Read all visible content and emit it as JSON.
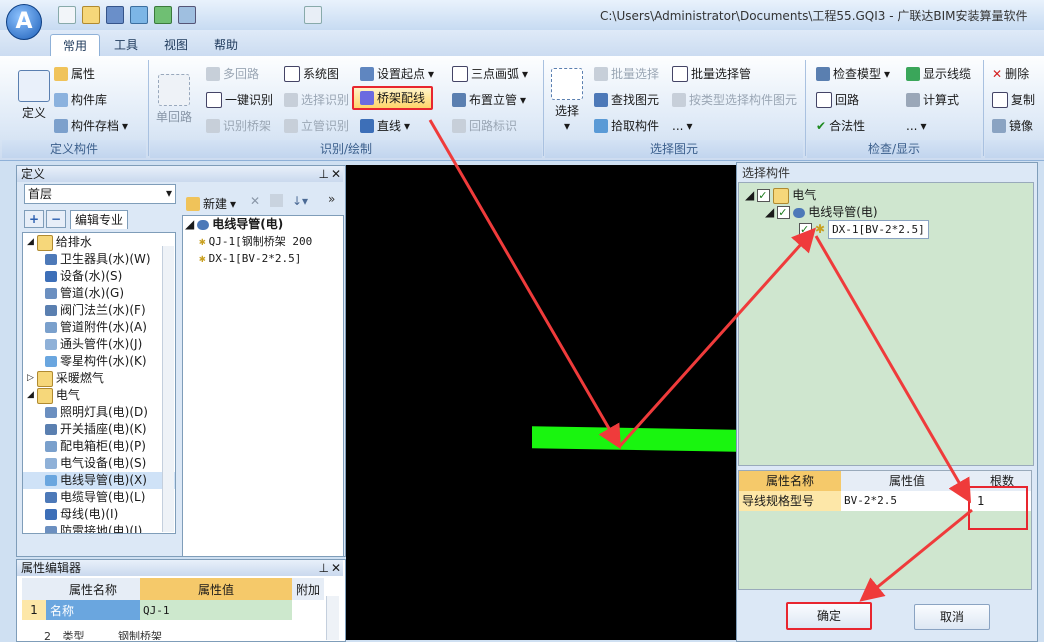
{
  "title": "C:\\Users\\Administrator\\Documents\\工程55.GQI3 - 广联达BIM安装算量软件",
  "app_logo": "A",
  "tabs": [
    "常用",
    "工具",
    "视图",
    "帮助"
  ],
  "ribbon": {
    "define_group": {
      "label": "定义构件",
      "define": "定义",
      "attr": "属性",
      "lib": "构件库",
      "store": "构件存档"
    },
    "draw_group": {
      "label": "识别/绘制",
      "single": "单回路",
      "multi": "多回路",
      "one_key": "一键识别",
      "bridge_recog": "识别桥架",
      "sysdiagram": "系统图",
      "select_recog": "选择识别",
      "riser_recog": "立管识别",
      "set_start": "设置起点",
      "tray_wire": "桥架配线",
      "line": "直线",
      "arc": "三点画弧",
      "riser": "布置立管",
      "loop_mark": "回路标识"
    },
    "select_group": {
      "label": "选择图元",
      "select": "选择",
      "batch": "批量选择",
      "find": "查找图元",
      "pick": "拾取构件",
      "batch_riser": "批量选择管",
      "by_type": "按类型选择构件图元",
      "more": "..."
    },
    "check_group": {
      "label": "检查/显示",
      "check_model": "检查模型",
      "loop": "回路",
      "legal": "合法性",
      "show_lines": "显示线缆",
      "formula": "计算式",
      "more": "..."
    },
    "edit_group": {
      "delete": "删除",
      "copy": "复制",
      "mirror": "镜像"
    }
  },
  "left_panel": {
    "title": "定义",
    "floor": "首层",
    "edit_specialty": "编辑专业",
    "tree": [
      {
        "label": "给排水",
        "level": 0,
        "expanded": true
      },
      {
        "label": "卫生器具(水)(W)",
        "level": 1
      },
      {
        "label": "设备(水)(S)",
        "level": 1
      },
      {
        "label": "管道(水)(G)",
        "level": 1
      },
      {
        "label": "阀门法兰(水)(F)",
        "level": 1
      },
      {
        "label": "管道附件(水)(A)",
        "level": 1
      },
      {
        "label": "通头管件(水)(J)",
        "level": 1
      },
      {
        "label": "零星构件(水)(K)",
        "level": 1
      },
      {
        "label": "采暖燃气",
        "level": 0,
        "expanded": false
      },
      {
        "label": "电气",
        "level": 0,
        "expanded": true
      },
      {
        "label": "照明灯具(电)(D)",
        "level": 1
      },
      {
        "label": "开关插座(电)(K)",
        "level": 1
      },
      {
        "label": "配电箱柜(电)(P)",
        "level": 1
      },
      {
        "label": "电气设备(电)(S)",
        "level": 1
      },
      {
        "label": "电线导管(电)(X)",
        "level": 1,
        "selected": true
      },
      {
        "label": "电缆导管(电)(L)",
        "level": 1
      },
      {
        "label": "母线(电)(I)",
        "level": 1
      },
      {
        "label": "防雷接地(电)(J)",
        "level": 1
      },
      {
        "label": "零星构件(电)(A)",
        "level": 1
      }
    ],
    "new_button": "新建",
    "component_root": "电线导管(电)",
    "components": [
      "QJ-1[钢制桥架 200",
      "DX-1[BV-2*2.5]"
    ]
  },
  "prop_editor": {
    "title": "属性编辑器",
    "headers": [
      "属性名称",
      "属性值",
      "附加"
    ],
    "rows": [
      {
        "index": "1",
        "name": "名称",
        "value": "QJ-1"
      },
      {
        "index": "2",
        "name": "类型",
        "value": "钢制桥架"
      }
    ]
  },
  "dialog": {
    "title": "选择构件",
    "tree": [
      {
        "label": "电气",
        "level": 0
      },
      {
        "label": "电线导管(电)",
        "level": 1
      },
      {
        "label": "DX-1[BV-2*2.5]",
        "level": 2
      }
    ],
    "grid_headers": [
      "属性名称",
      "属性值",
      "根数"
    ],
    "grid_row": {
      "name": "导线规格型号",
      "value": "BV-2*2.5",
      "count": "1"
    },
    "ok": "确定",
    "cancel": "取消"
  },
  "colors": {
    "highlight": "#e8262f",
    "canvas": "#000000",
    "segment": "#19f50f"
  }
}
